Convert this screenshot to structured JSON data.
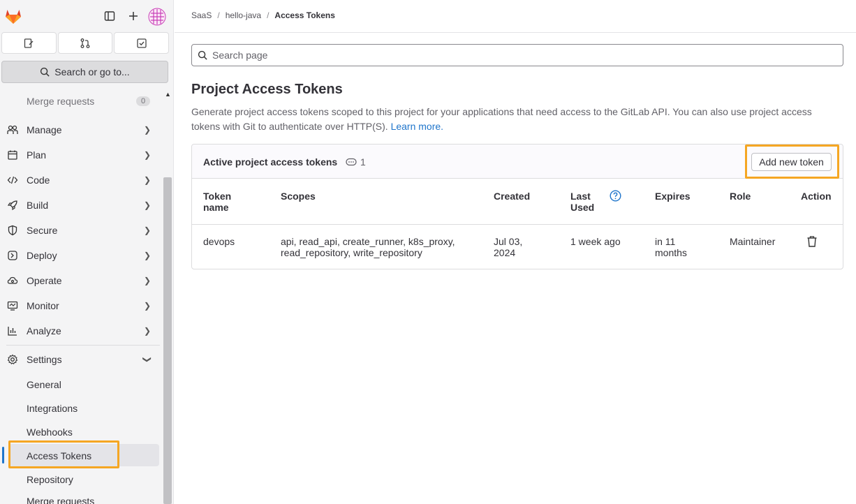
{
  "sidebar": {
    "quick_icons": [
      "issues-icon",
      "merge-request-icon",
      "todo-icon"
    ],
    "search_label": "Search or go to...",
    "merge_requests_top": {
      "label": "Merge requests",
      "count": "0"
    },
    "items": [
      {
        "label": "Manage",
        "icon": "users-icon"
      },
      {
        "label": "Plan",
        "icon": "calendar-icon"
      },
      {
        "label": "Code",
        "icon": "code-icon"
      },
      {
        "label": "Build",
        "icon": "rocket-icon"
      },
      {
        "label": "Secure",
        "icon": "shield-icon"
      },
      {
        "label": "Deploy",
        "icon": "deploy-icon"
      },
      {
        "label": "Operate",
        "icon": "cloud-icon"
      },
      {
        "label": "Monitor",
        "icon": "monitor-icon"
      },
      {
        "label": "Analyze",
        "icon": "chart-icon"
      }
    ],
    "settings": {
      "label": "Settings",
      "sub": [
        "General",
        "Integrations",
        "Webhooks",
        "Access Tokens",
        "Repository",
        "Merge requests"
      ],
      "active": "Access Tokens"
    }
  },
  "breadcrumb": [
    "SaaS",
    "hello-java",
    "Access Tokens"
  ],
  "search_placeholder": "Search page",
  "page": {
    "title": "Project Access Tokens",
    "description": "Generate project access tokens scoped to this project for your applications that need access to the GitLab API. You can also use project access tokens with Git to authenticate over HTTP(S).",
    "learn_more": "Learn more."
  },
  "tokens_card": {
    "title": "Active project access tokens",
    "count": "1",
    "add_button": "Add new token",
    "headers": {
      "name": "Token name",
      "scopes": "Scopes",
      "created": "Created",
      "last_used": "Last Used",
      "expires": "Expires",
      "role": "Role",
      "action": "Action"
    },
    "rows": [
      {
        "name": "devops",
        "scopes": "api, read_api, create_runner, k8s_proxy, read_repository, write_repository",
        "created": "Jul 03, 2024",
        "last_used": "1 week ago",
        "expires": "in 11 months",
        "role": "Maintainer"
      }
    ]
  },
  "colors": {
    "accent": "#1f75cb",
    "highlight": "#f5a623",
    "logo": "#e24329"
  }
}
